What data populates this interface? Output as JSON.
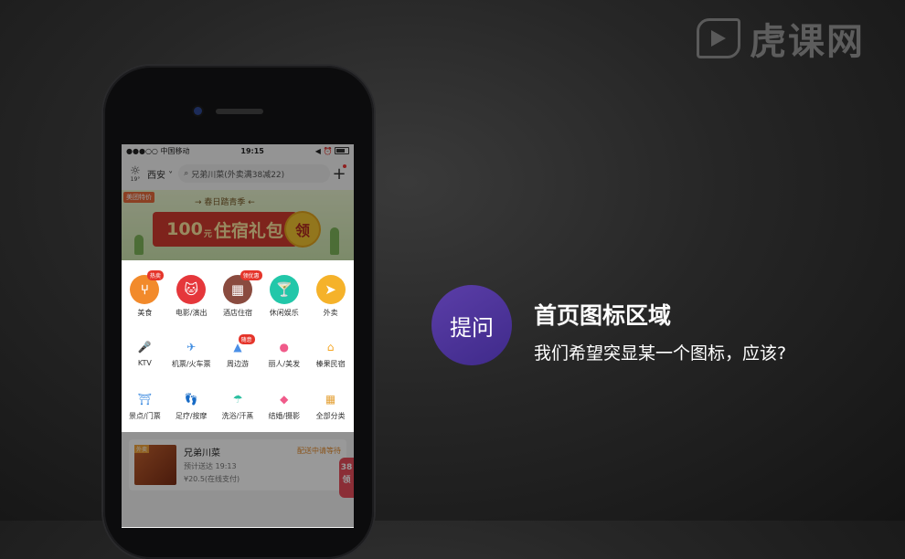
{
  "watermark": {
    "text": "虎课网"
  },
  "phone": {
    "status_bar": {
      "carrier": "●●●○○ 中国移动",
      "wifi_icon": "wifi-icon",
      "time": "19:15",
      "right": "◀ ⏰"
    },
    "header": {
      "weather_temp": "19°",
      "city": "西安",
      "search_placeholder": "兄弟川菜(外卖满38减22)",
      "plus": "+"
    },
    "banner": {
      "tag": "美团特价",
      "subtitle": "→ 春日踏青季 ←",
      "amount": "100",
      "unit": "元",
      "text": "住宿礼包",
      "badge": "领"
    },
    "categories_primary": [
      {
        "label": "美食",
        "icon": "fork-knife-icon",
        "glyph": "⑂",
        "color": "#f28a2b",
        "badge": "热卖"
      },
      {
        "label": "电影/演出",
        "icon": "cat-mask-icon",
        "glyph": "🐱",
        "color": "#e5373b",
        "badge": ""
      },
      {
        "label": "酒店住宿",
        "icon": "building-icon",
        "glyph": "▦",
        "color": "#8a4b3f",
        "badge": "领优惠"
      },
      {
        "label": "休闲娱乐",
        "icon": "cocktail-icon",
        "glyph": "🍸",
        "color": "#22c7a9",
        "badge": ""
      },
      {
        "label": "外卖",
        "icon": "delivery-icon",
        "glyph": "➤",
        "color": "#f5b22a",
        "badge": ""
      }
    ],
    "categories_secondary": [
      {
        "label": "KTV",
        "icon": "microphone-icon",
        "glyph": "🎤",
        "color": "#2bbf8a",
        "badge": ""
      },
      {
        "label": "机票/火车票",
        "icon": "plane-icon",
        "glyph": "✈",
        "color": "#3d8be0",
        "badge": ""
      },
      {
        "label": "周边游",
        "icon": "mountain-icon",
        "glyph": "▲",
        "color": "#4a8fe7",
        "badge": "随意"
      },
      {
        "label": "丽人/美发",
        "icon": "woman-icon",
        "glyph": "●",
        "color": "#f05b8a",
        "badge": ""
      },
      {
        "label": "榛果民宿",
        "icon": "house-icon",
        "glyph": "⌂",
        "color": "#f5a623",
        "badge": ""
      }
    ],
    "categories_tertiary": [
      {
        "label": "景点/门票",
        "icon": "pagoda-icon",
        "glyph": "⛩",
        "color": "#3d8be0",
        "badge": ""
      },
      {
        "label": "足疗/按摩",
        "icon": "foot-icon",
        "glyph": "👣",
        "color": "#2bbf8a",
        "badge": ""
      },
      {
        "label": "洗浴/汗蒸",
        "icon": "shower-icon",
        "glyph": "☂",
        "color": "#2bbfa0",
        "badge": ""
      },
      {
        "label": "结婚/摄影",
        "icon": "diamond-icon",
        "glyph": "◆",
        "color": "#f05b8a",
        "badge": ""
      },
      {
        "label": "全部分类",
        "icon": "grid-icon",
        "glyph": "▦",
        "color": "#e5a33a",
        "badge": ""
      }
    ],
    "order": {
      "thumb_tag": "外卖",
      "name": "兄弟川菜",
      "status": "配送中请等待",
      "eta": "预计送达 19:13",
      "price": "¥20.5(在线支付)",
      "side_tag": "38"
    }
  },
  "callout": {
    "circle_text": "提问",
    "title": "首页图标区域",
    "subtitle": "我们希望突显某一个图标，应该?"
  }
}
